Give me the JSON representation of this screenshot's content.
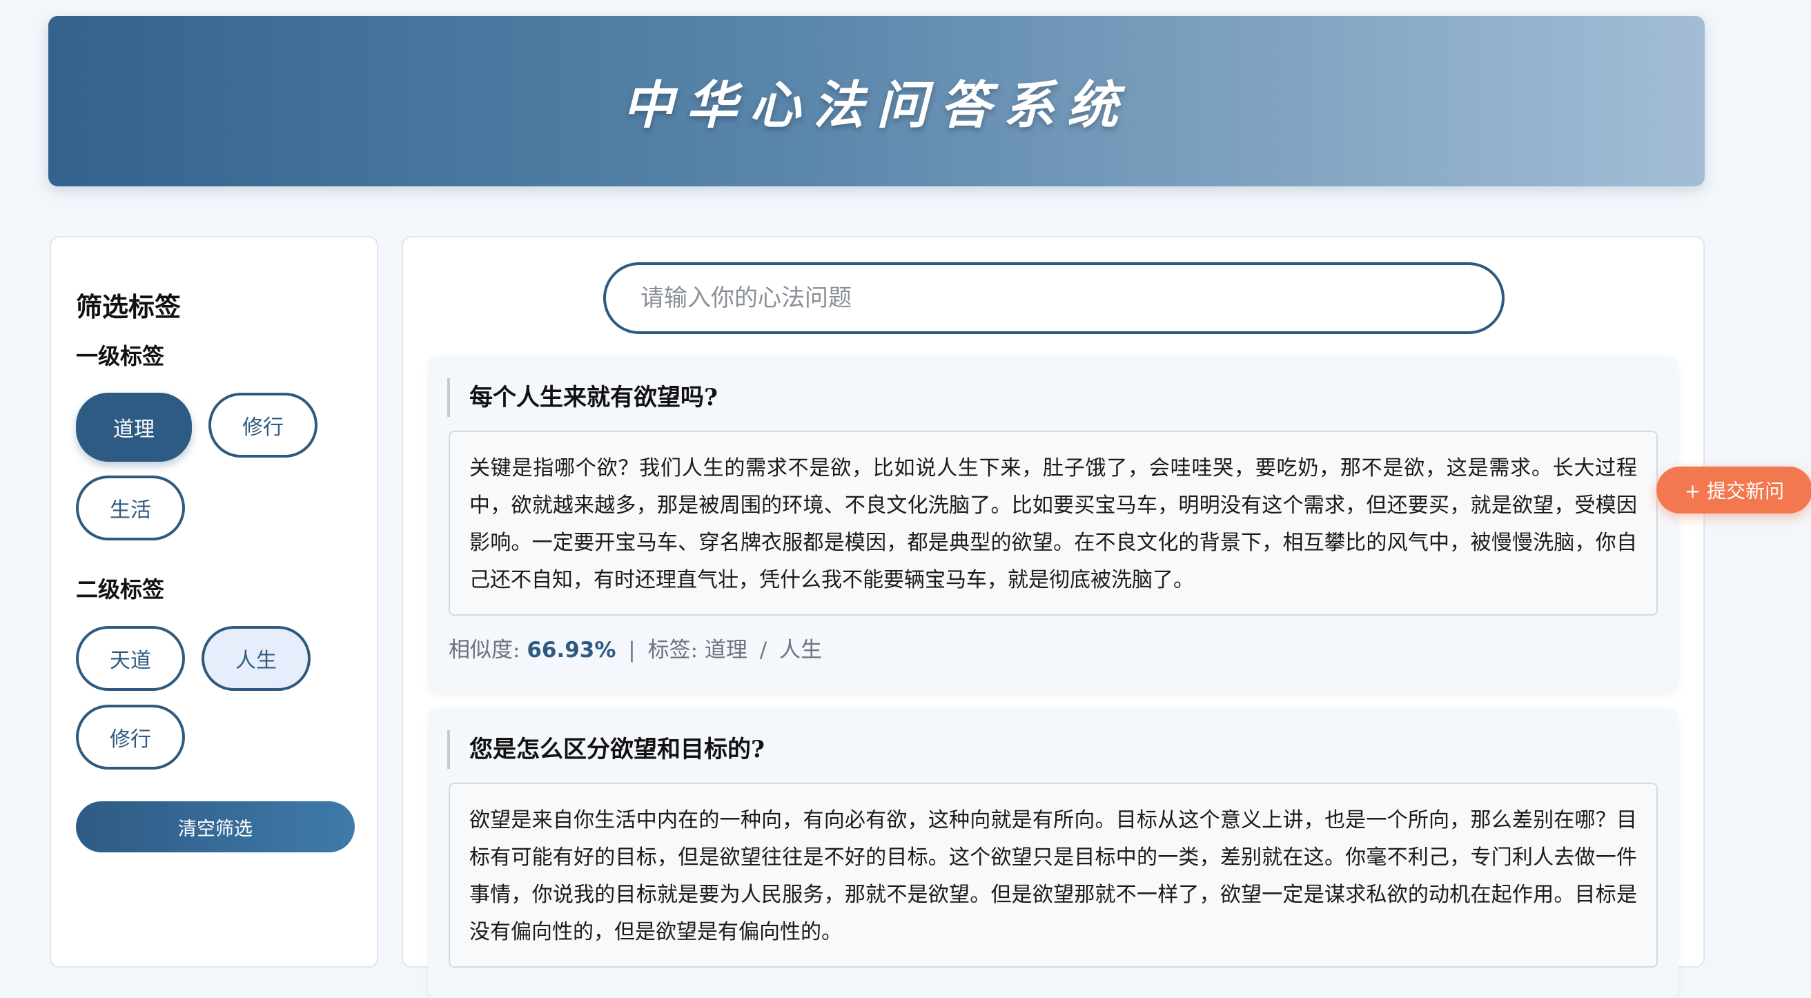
{
  "header": {
    "title": "中华心法问答系统"
  },
  "sidebar": {
    "title": "筛选标签",
    "primary_heading": "一级标签",
    "primary_tags": [
      "道理",
      "修行",
      "生活"
    ],
    "secondary_heading": "二级标签",
    "secondary_tags": [
      "天道",
      "人生",
      "修行"
    ],
    "clear_label": "清空筛选"
  },
  "search": {
    "placeholder": "请输入你的心法问题"
  },
  "results": [
    {
      "question": "每个人生来就有欲望吗?",
      "answer": "关键是指哪个欲？我们人生的需求不是欲，比如说人生下来，肚子饿了，会哇哇哭，要吃奶，那不是欲，这是需求。长大过程中，欲就越来越多，那是被周围的环境、不良文化洗脑了。比如要买宝马车，明明没有这个需求，但还要买，就是欲望，受模因影响。一定要开宝马车、穿名牌衣服都是模因，都是典型的欲望。在不良文化的背景下，相互攀比的风气中，被慢慢洗脑，你自己还不自知，有时还理直气壮，凭什么我不能要辆宝马车，就是彻底被洗脑了。",
      "similarity_label": "相似度:",
      "similarity": "66.93%",
      "tags_label": "标签:",
      "tag1": "道理",
      "tag2": "人生"
    },
    {
      "question": "您是怎么区分欲望和目标的?",
      "answer": "欲望是来自你生活中内在的一种向，有向必有欲，这种向就是有所向。目标从这个意义上讲，也是一个所向，那么差别在哪？目标有可能有好的目标，但是欲望往往是不好的目标。这个欲望只是目标中的一类，差别就在这。你毫不利己，专门利人去做一件事情，你说我的目标就是要为人民服务，那就不是欲望。但是欲望那就不一样了，欲望一定是谋求私欲的动机在起作用。目标是没有偏向性的，但是欲望是有偏向性的。"
    }
  ],
  "fab": {
    "label": "+ 提交新问"
  }
}
